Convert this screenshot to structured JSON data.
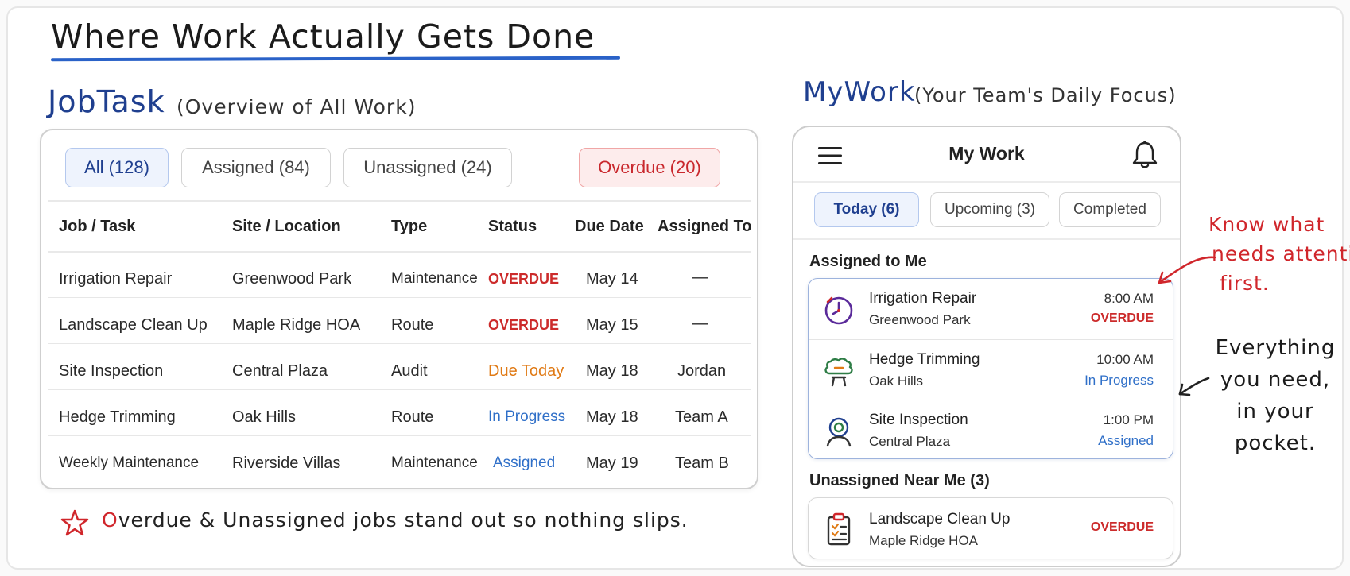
{
  "headline": "Where Work Actually Gets Done",
  "jobtask": {
    "heading": "JobTask",
    "subheading": "(Overview of All Work)",
    "filters": [
      {
        "label": "All (128)"
      },
      {
        "label": "Assigned (84)"
      },
      {
        "label": "Unassigned (24)"
      },
      {
        "label": "Overdue (20)"
      }
    ],
    "columns": [
      "Job / Task",
      "Site / Location",
      "Type",
      "Status",
      "Due Date",
      "Assigned To"
    ],
    "rows": [
      {
        "job": "Irrigation Repair",
        "site": "Greenwood Park",
        "type": "Maintenance",
        "status": "OVERDUE",
        "due": "May 14",
        "assigned": "—"
      },
      {
        "job": "Landscape Clean Up",
        "site": "Maple Ridge HOA",
        "type": "Route",
        "status": "OVERDUE",
        "due": "May 15",
        "assigned": "—"
      },
      {
        "job": "Site Inspection",
        "site": "Central Plaza",
        "type": "Audit",
        "status": "Due Today",
        "due": "May 18",
        "assigned": "Jordan"
      },
      {
        "job": "Hedge Trimming",
        "site": "Oak Hills",
        "type": "Route",
        "status": "In Progress",
        "due": "May 18",
        "assigned": "Team A"
      },
      {
        "job": "Weekly Maintenance",
        "site": "Riverside Villas",
        "type": "Maintenance",
        "status": "Assigned",
        "due": "May 19",
        "assigned": "Team B"
      }
    ],
    "footnote_lead": "O",
    "footnote_rest": "verdue & Unassigned jobs stand out so nothing slips."
  },
  "mywork": {
    "heading": "MyWork",
    "subheading": "(Your Team's Daily Focus)",
    "app_title": "My Work",
    "tabs": [
      {
        "label": "Today (6)"
      },
      {
        "label": "Upcoming (3)"
      },
      {
        "label": "Completed"
      }
    ],
    "assigned_section": "Assigned to Me",
    "assigned_items": [
      {
        "title": "Irrigation Repair",
        "site": "Greenwood Park",
        "time": "8:00 AM",
        "status": "OVERDUE"
      },
      {
        "title": "Hedge Trimming",
        "site": "Oak Hills",
        "time": "10:00 AM",
        "status": "In Progress"
      },
      {
        "title": "Site Inspection",
        "site": "Central Plaza",
        "time": "1:00 PM",
        "status": "Assigned"
      }
    ],
    "unassigned_section": "Unassigned Near Me (3)",
    "unassigned_items": [
      {
        "title": "Landscape Clean Up",
        "site": "Maple Ridge HOA",
        "status": "OVERDUE"
      }
    ]
  },
  "annotations": {
    "attention": [
      "Know what",
      "needs attention",
      "first."
    ],
    "pocket": [
      "Everything",
      "you need,",
      "in your",
      "pocket."
    ]
  },
  "colors": {
    "accent_blue": "#1f3f8f",
    "overdue_red": "#cc2b2b",
    "due_today_orange": "#e07a15",
    "progress_blue": "#2f6fc8"
  }
}
